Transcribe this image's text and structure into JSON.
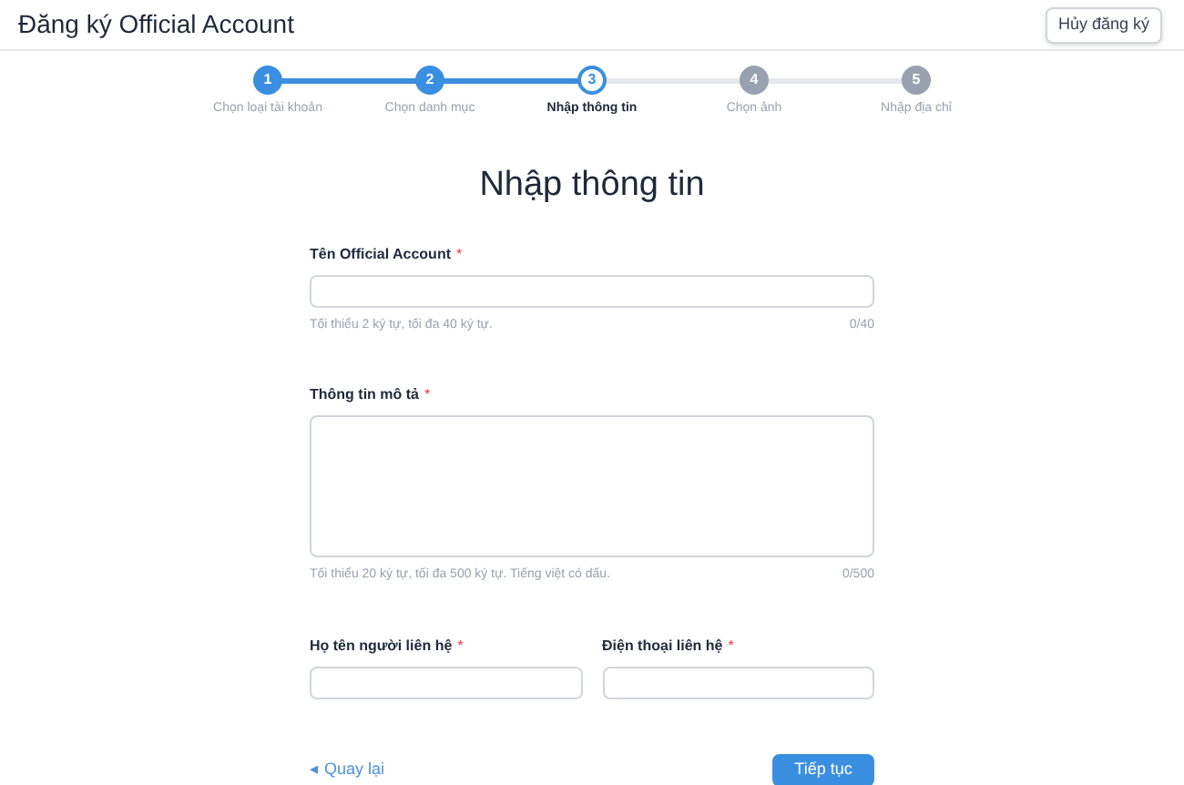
{
  "header": {
    "title": "Đăng ký Official Account",
    "cancel_button": "Hủy đăng ký"
  },
  "steps": [
    {
      "number": "1",
      "label": "Chọn loại tài khoản",
      "completed": true,
      "selected": false
    },
    {
      "number": "2",
      "label": "Chọn danh mục",
      "completed": true,
      "selected": false
    },
    {
      "number": "3",
      "label": "Nhập thông tin",
      "completed": false,
      "selected": true
    },
    {
      "number": "4",
      "label": "Chọn ảnh",
      "completed": false,
      "selected": false
    },
    {
      "number": "5",
      "label": "Nhập địa chỉ",
      "completed": false,
      "selected": false
    }
  ],
  "form": {
    "heading": "Nhập thông tin",
    "name_field": {
      "label": "Tên Official Account",
      "required_mark": "*",
      "hint": "Tối thiểu 2 ký tự, tối đa 40 ký tự.",
      "counter": "0/40"
    },
    "description_field": {
      "label": "Thông tin mô tả",
      "required_mark": "*",
      "hint": "Tối thiểu 20 ký tự, tối đa 500 ký tự. Tiếng việt có dấu.",
      "counter": "0/500"
    },
    "contact_fields": [
      {
        "label": "Họ tên người liên hệ",
        "required_mark": "*"
      },
      {
        "label": "Điện thoại liên hệ",
        "required_mark": "*"
      }
    ],
    "back_link": {
      "icon": "◂",
      "label": "Quay lại"
    },
    "continue_button": "Tiếp tục"
  }
}
